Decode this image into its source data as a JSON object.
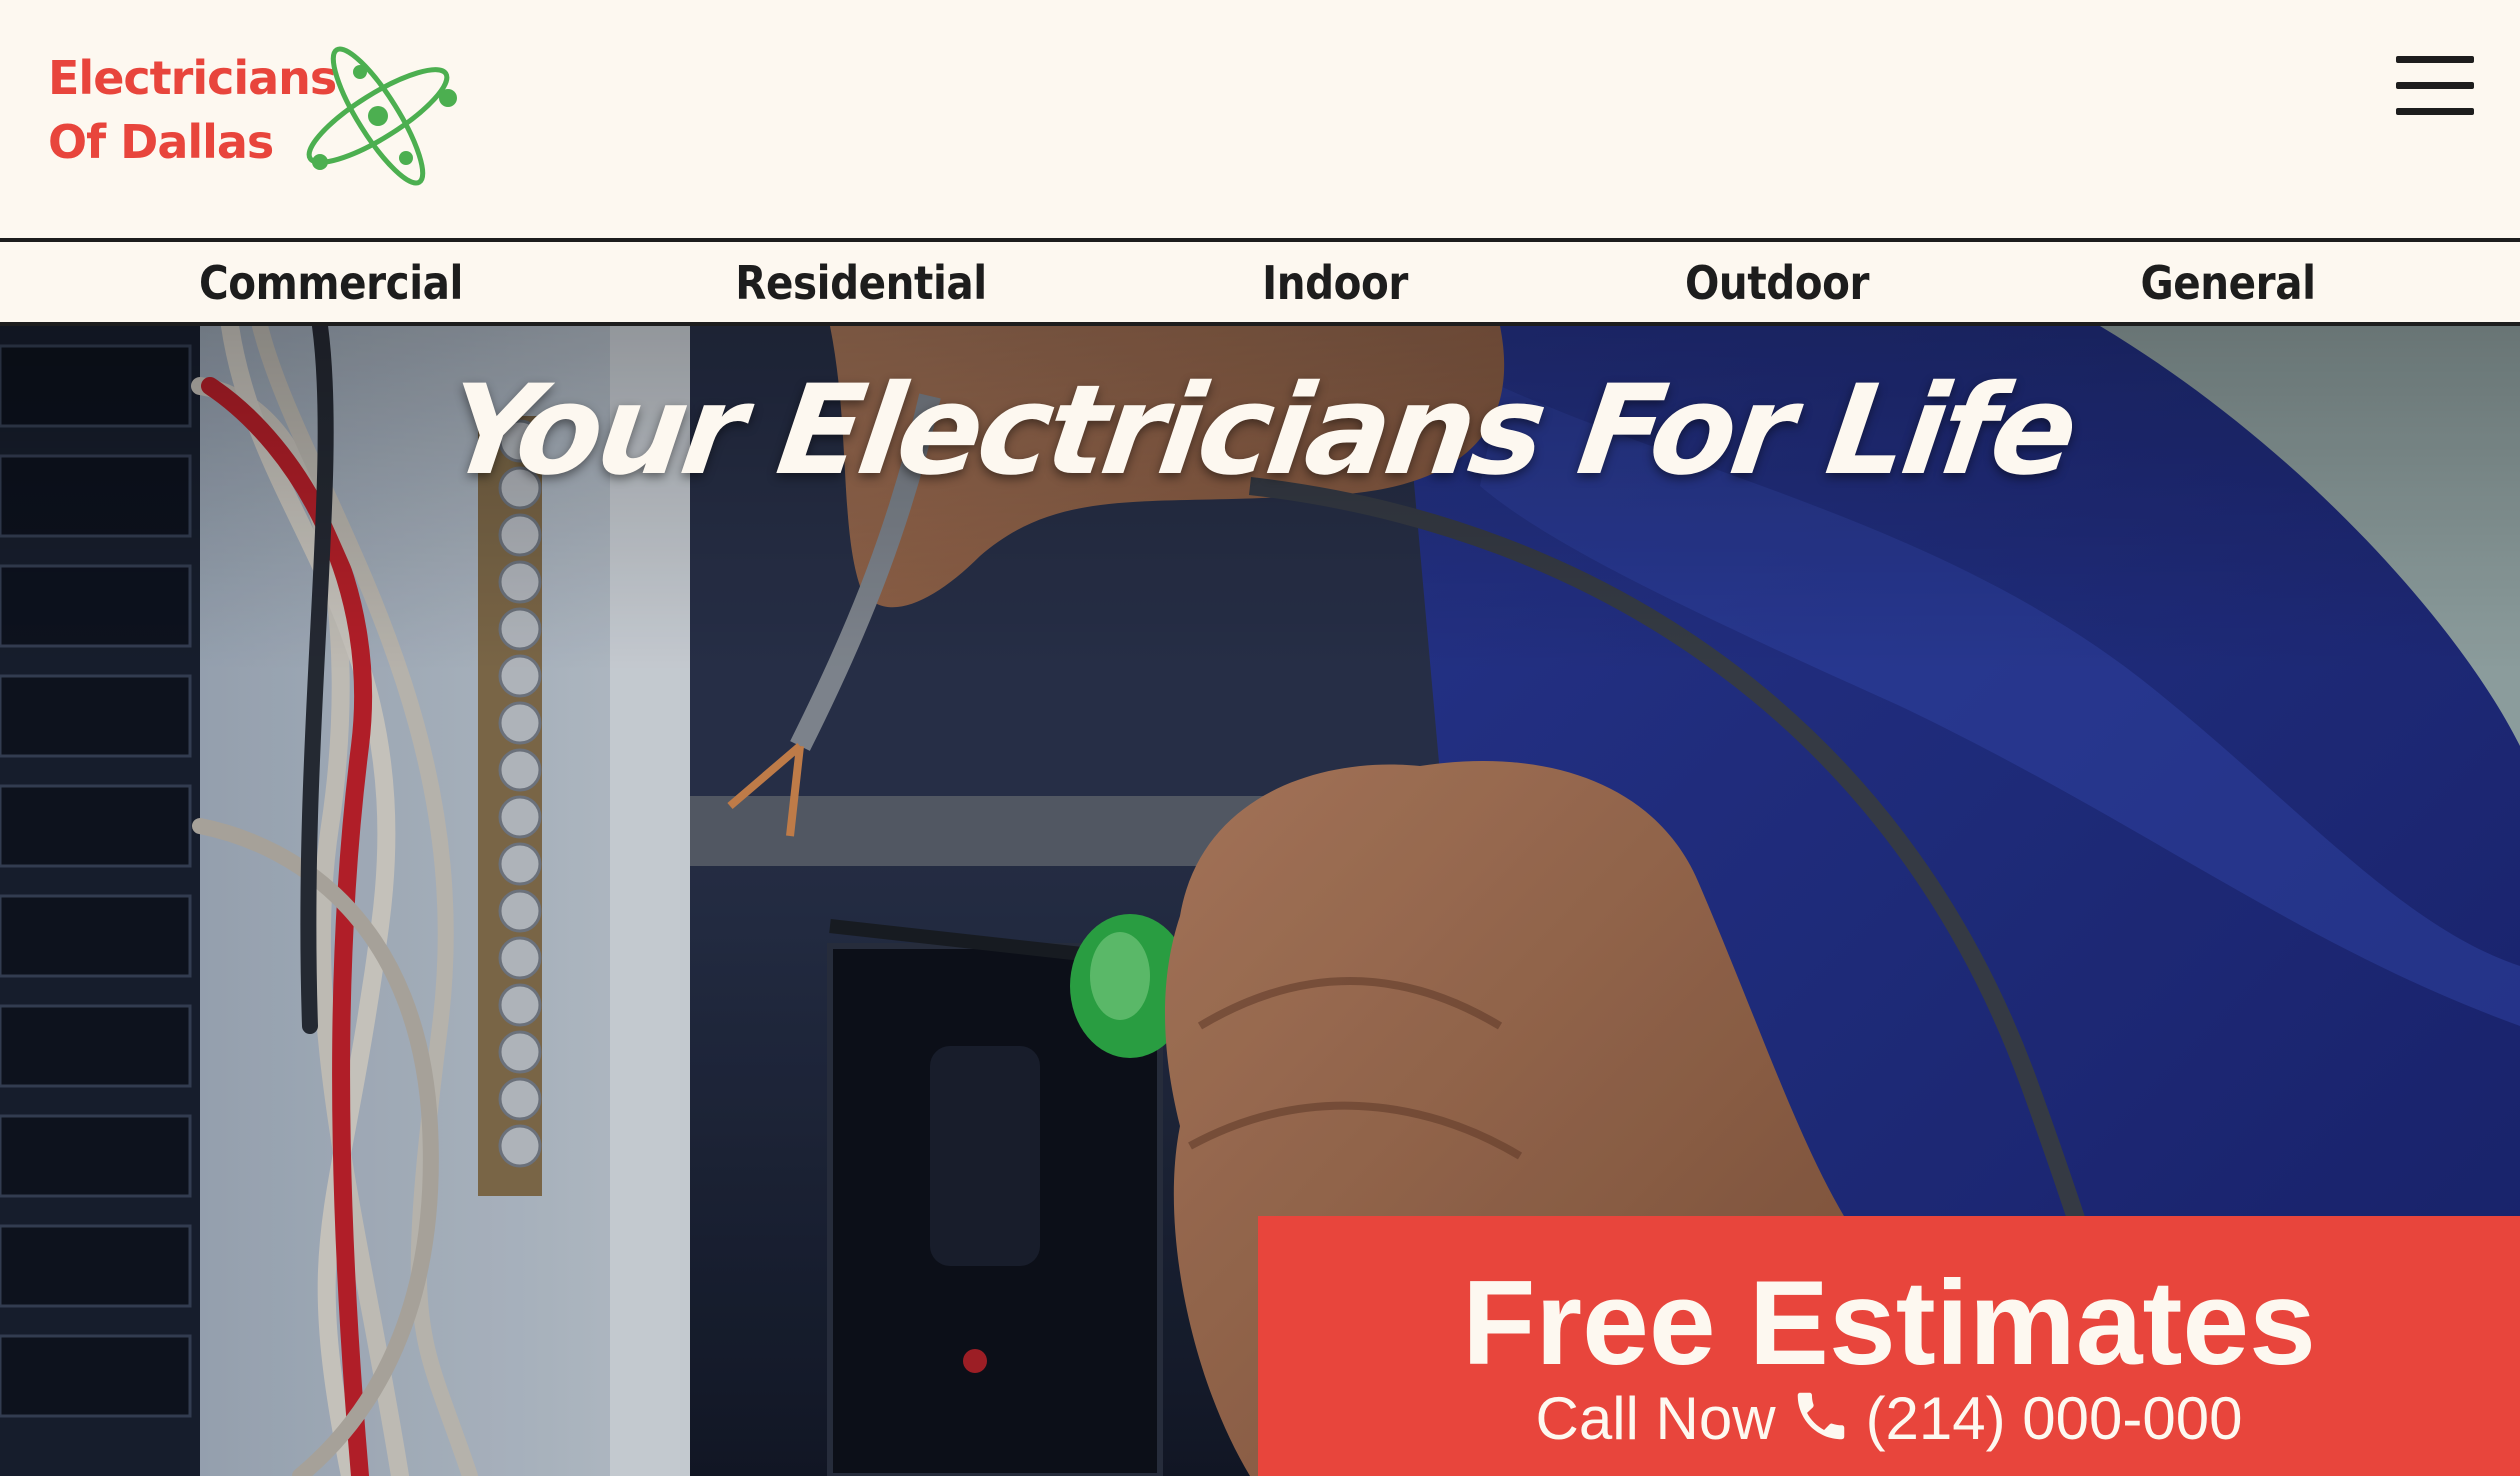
{
  "brand": {
    "line1": "Electricians",
    "line2": "Of Dallas",
    "color": "#e8453c",
    "atom_color": "#4caf50"
  },
  "header": {
    "menu_icon": "hamburger-menu-icon"
  },
  "nav": {
    "items": [
      {
        "label": "Commercial"
      },
      {
        "label": "Residential"
      },
      {
        "label": "Indoor"
      },
      {
        "label": "Outdoor"
      },
      {
        "label": "General"
      }
    ]
  },
  "hero": {
    "tagline": "Your Electricians For Life",
    "image_subject": "electrician-hands-working-in-breaker-panel"
  },
  "cta": {
    "title": "Free Estimates",
    "call_label": "Call Now",
    "phone_icon": "phone-icon",
    "phone": "(214) 000-000",
    "background": "#e8453c"
  }
}
